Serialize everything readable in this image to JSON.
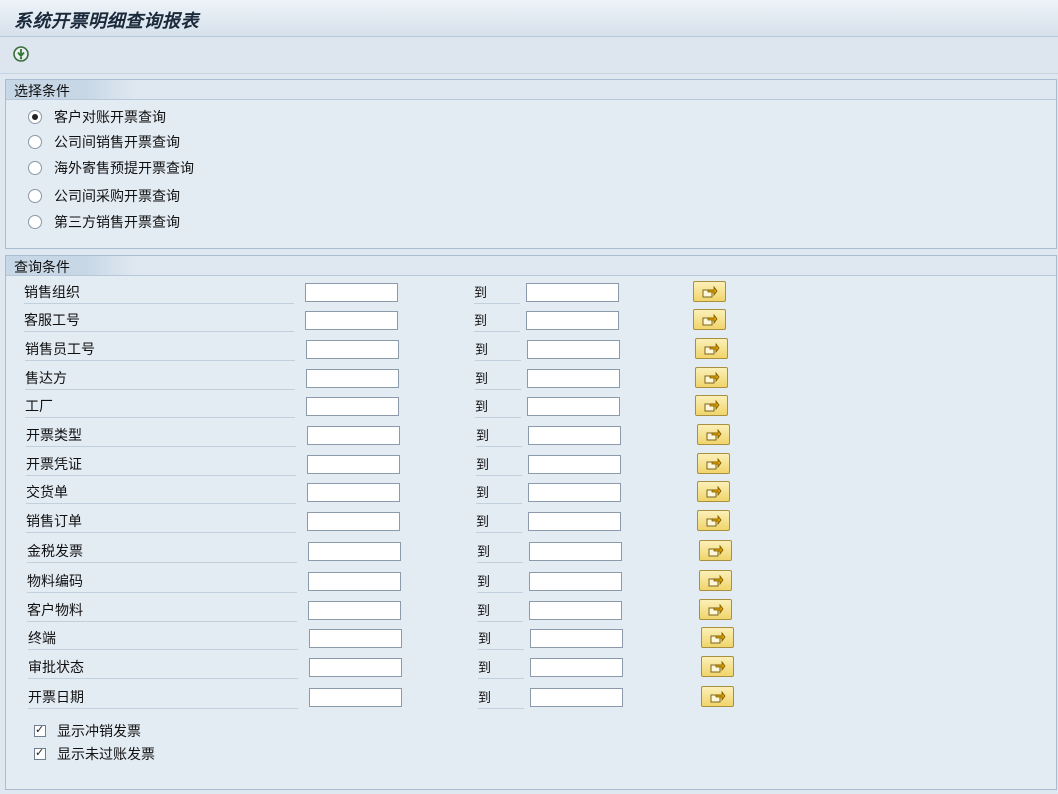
{
  "window": {
    "title": "系统开票明细查询报表"
  },
  "toolbar": {
    "execute_icon": "execute-icon"
  },
  "selection": {
    "title": "选择条件",
    "options": [
      {
        "label": "客户对账开票查询",
        "checked": true
      },
      {
        "label": "公司间销售开票查询",
        "checked": false
      },
      {
        "label": "海外寄售预提开票查询",
        "checked": false
      },
      {
        "label": "公司间采购开票查询",
        "checked": false
      },
      {
        "label": "第三方销售开票查询",
        "checked": false
      }
    ]
  },
  "query": {
    "title": "查询条件",
    "to_label": "到",
    "fields": [
      {
        "label": "销售组织",
        "from": "",
        "to": ""
      },
      {
        "label": "客服工号",
        "from": "",
        "to": ""
      },
      {
        "label": "销售员工号",
        "from": "",
        "to": ""
      },
      {
        "label": "售达方",
        "from": "",
        "to": ""
      },
      {
        "label": "工厂",
        "from": "",
        "to": ""
      },
      {
        "label": "开票类型",
        "from": "",
        "to": ""
      },
      {
        "label": "开票凭证",
        "from": "",
        "to": ""
      },
      {
        "label": "交货单",
        "from": "",
        "to": ""
      },
      {
        "label": "销售订单",
        "from": "",
        "to": ""
      },
      {
        "label": "金税发票",
        "from": "",
        "to": ""
      },
      {
        "label": "物料编码",
        "from": "",
        "to": ""
      },
      {
        "label": "客户物料",
        "from": "",
        "to": ""
      },
      {
        "label": "终端",
        "from": "",
        "to": ""
      },
      {
        "label": "审批状态",
        "from": "",
        "to": ""
      },
      {
        "label": "开票日期",
        "from": "",
        "to": ""
      }
    ],
    "checkboxes": [
      {
        "label": "显示冲销发票",
        "checked": true
      },
      {
        "label": "显示未过账发票",
        "checked": true
      }
    ]
  },
  "colors": {
    "button": "#f1d56b",
    "background": "#dfe8f1",
    "group_border": "#a9bdd2"
  }
}
